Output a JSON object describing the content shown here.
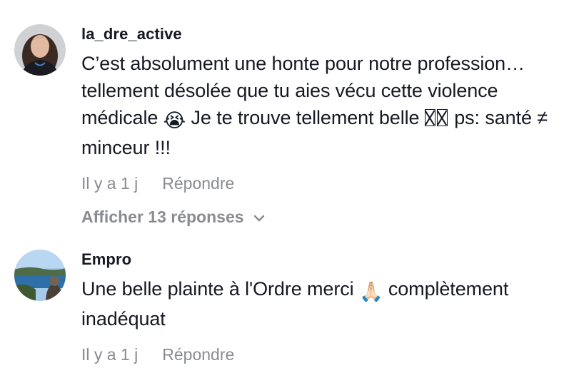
{
  "comments": [
    {
      "username": "la_dre_active",
      "text_main": "C’est absolument une honte pour notre profession… tellement désolée que tu aies vécu cette violence médicale",
      "emoji_1": "😭",
      "text_mid": " Je te trouve tellement belle ",
      "text_end": " ps: santé ≠ minceur !!!",
      "time": "Il y a 1 j",
      "reply_label": "Répondre",
      "view_replies": "Afficher 13 réponses"
    },
    {
      "username": "Empro",
      "text_before": "Une belle plainte à l'Ordre merci ",
      "emoji": "🙏🏻",
      "text_after": " complètement inadéquat",
      "time": "Il y a 1 j",
      "reply_label": "Répondre"
    }
  ],
  "icons": {
    "chevron": "chevron-down-icon",
    "broken_glyph": "missing-glyph-icon"
  },
  "colors": {
    "text": "#161823",
    "meta": "#8a8b91",
    "background": "#ffffff"
  }
}
